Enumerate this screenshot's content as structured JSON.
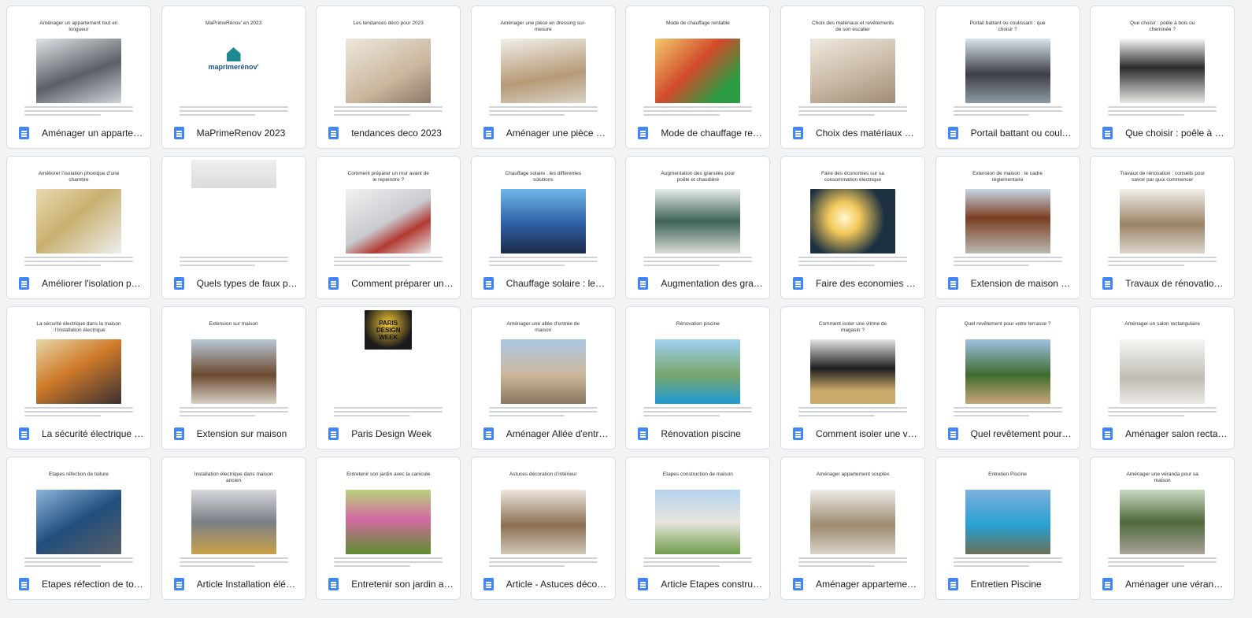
{
  "files": [
    {
      "label": "Aménager un appartement tout en longueur",
      "doc_title": "Aménager un appartement tout en longueur"
    },
    {
      "label": "MaPrimeRenov 2023",
      "doc_title": "MaPrimeRénov’ en 2023"
    },
    {
      "label": "tendances deco 2023",
      "doc_title": "Les tendances déco pour 2023"
    },
    {
      "label": "Aménager une pièce en dressing sur-mesure",
      "doc_title": "Aménager une pièce en dressing sur-mesure"
    },
    {
      "label": "Mode de chauffage rentable",
      "doc_title": "Mode de chauffage rentable"
    },
    {
      "label": "Choix des matériaux et revêtements de son escalier",
      "doc_title": "Choix des matériaux et revêtements de son escalier"
    },
    {
      "label": "Portail battant ou coulissant",
      "doc_title": "Portail battant ou coulissant : que choisir ?"
    },
    {
      "label": "Que choisir : poêle à bois ou cheminée",
      "doc_title": "Que choisir : poêle à bois ou cheminée ?"
    },
    {
      "label": "Améliorer l'isolation phonique",
      "doc_title": "Améliorer l’isolation phonique d’une chambre"
    },
    {
      "label": "Quels types de faux plafonds",
      "doc_title": ""
    },
    {
      "label": "Comment préparer un mur",
      "doc_title": "Comment préparer un mur avant de le repeindre ?"
    },
    {
      "label": "Chauffage solaire : les différentes solutions",
      "doc_title": "Chauffage solaire : les différentes solutions"
    },
    {
      "label": "Augmentation des granulés pour poêle",
      "doc_title": "Augmentation des granulés pour poêle et chaudière"
    },
    {
      "label": "Faire des economies sur sa consommation",
      "doc_title": "Faire des économies sur sa consommation électrique"
    },
    {
      "label": "Extension de maison : le cadre réglementaire",
      "doc_title": "Extension de maison : le cadre réglementaire"
    },
    {
      "label": "Travaux de rénovation : conseils",
      "doc_title": "Travaux de rénovation : conseils pour savoir par quoi commencer"
    },
    {
      "label": "La sécurité électrique dans la maison",
      "doc_title": "La sécurité électrique dans la maison : l’installation électrique"
    },
    {
      "label": "Extension sur maison",
      "doc_title": "Extension sur maison"
    },
    {
      "label": "Paris Design Week",
      "doc_title": ""
    },
    {
      "label": "Aménager Allée d'entrée de maison",
      "doc_title": "Aménager une allée d’entrée de maison"
    },
    {
      "label": "Rénovation piscine",
      "doc_title": "Rénovation piscine"
    },
    {
      "label": "Comment isoler une vitrine de magasin",
      "doc_title": "Comment isoler une vitrine de magasin ?"
    },
    {
      "label": "Quel revêtement pour votre terrasse",
      "doc_title": "Quel revêtement pour votre terrasse ?"
    },
    {
      "label": "Aménager salon rectangulaire",
      "doc_title": "Aménager un salon rectangulaire"
    },
    {
      "label": "Etapes réfection de toiture",
      "doc_title": "Etapes réfection de toiture"
    },
    {
      "label": "Article Installation éléctrique",
      "doc_title": "Installation électrique dans maison ancien"
    },
    {
      "label": "Entretenir son jardin avec la canicule",
      "doc_title": "Entretenir son jardin avec la canicule"
    },
    {
      "label": "Article - Astuces décoration d'intérieur",
      "doc_title": "Astuces décoration d’intérieur"
    },
    {
      "label": "Article Etapes construction de maison",
      "doc_title": "Etapes construction de maison"
    },
    {
      "label": "Aménager appartement souplex",
      "doc_title": "Aménager appartement souplex"
    },
    {
      "label": "Entretien Piscine",
      "doc_title": "Entretien Piscine"
    },
    {
      "label": "Aménager une véranda pour sa maison",
      "doc_title": "Aménager une véranda pour sa maison"
    }
  ],
  "colors": {
    "background": "#f1f3f4",
    "card": "#ffffff",
    "doc_icon": "#4285f4",
    "text": "#202124"
  },
  "icons": {
    "file_type": "google-docs-icon"
  },
  "thumb_logo": {
    "text": "maprimerénov'"
  },
  "thumb_event": {
    "text": "PARIS DESIGN WEEK"
  }
}
